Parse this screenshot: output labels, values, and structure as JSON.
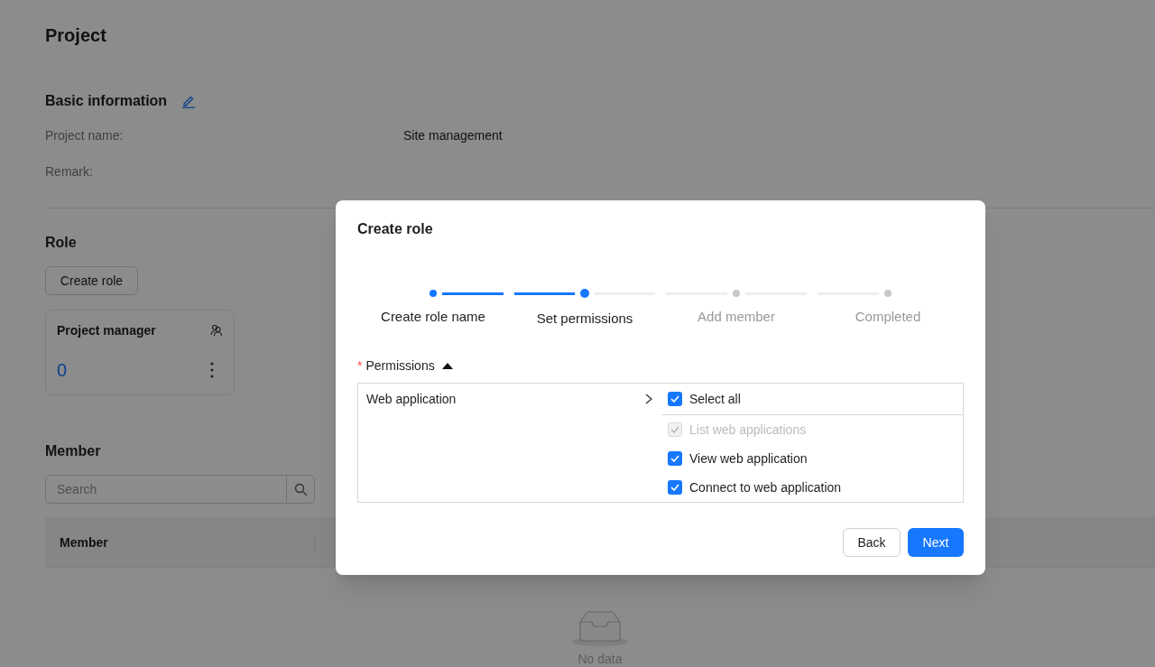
{
  "page": {
    "title": "Project"
  },
  "basic_info": {
    "title": "Basic information",
    "fields": [
      {
        "label": "Project name:",
        "value": "Site management"
      },
      {
        "label": "Remark:"
      }
    ]
  },
  "role": {
    "title": "Role",
    "create_button": "Create role",
    "cards": [
      {
        "name": "Project manager",
        "count": "0"
      }
    ]
  },
  "member": {
    "title": "Member",
    "search": {
      "placeholder": "Search"
    },
    "table": {
      "columns": [
        "Member"
      ],
      "empty_text": "No data"
    }
  },
  "dialog": {
    "title": "Create role",
    "steps": [
      {
        "label": "Create role name",
        "done": true,
        "selected": false
      },
      {
        "label": "Set permissions",
        "done": false,
        "selected": true
      },
      {
        "label": "Add member",
        "done": false,
        "selected": false
      },
      {
        "label": "Completed",
        "done": false,
        "selected": false
      }
    ],
    "permissions": {
      "label": "Permissions",
      "required_mark": "*",
      "expanded": true,
      "categories": [
        {
          "name": "Web application",
          "selected": true
        }
      ],
      "select_all": {
        "label": "Select all",
        "checked": true
      },
      "items": [
        {
          "label": "List web applications",
          "checked": true,
          "disabled": true
        },
        {
          "label": "View web application",
          "checked": true,
          "disabled": false
        },
        {
          "label": "Connect to web application",
          "checked": true,
          "disabled": false
        }
      ]
    },
    "buttons": [
      {
        "label": "Back",
        "kind": "secondary"
      },
      {
        "label": "Next",
        "kind": "primary"
      }
    ]
  }
}
